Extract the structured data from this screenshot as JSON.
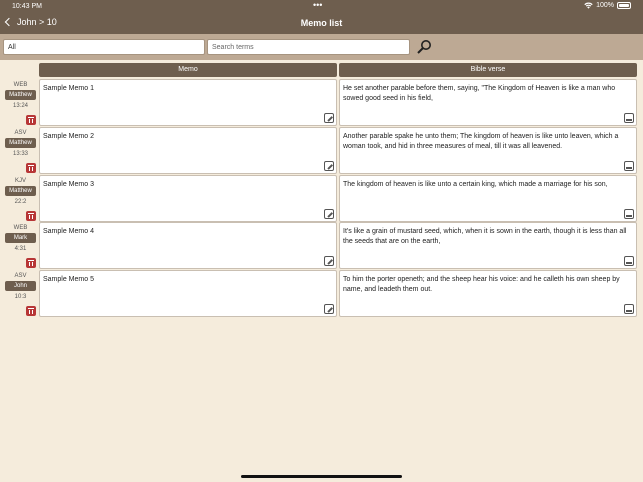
{
  "status": {
    "time": "10:43 PM",
    "battery": "100%",
    "dots": "•••"
  },
  "nav": {
    "back_label": "John > 10",
    "title": "Memo list"
  },
  "filter": {
    "version_value": "All",
    "search_placeholder": "Search terms"
  },
  "columns": {
    "memo": "Memo",
    "verse": "Bible verse"
  },
  "rows": [
    {
      "version": "WEB",
      "book": "Matthew",
      "ref": "13:24",
      "memo": "Sample Memo 1",
      "verse": "He set another parable before them, saying, \"The Kingdom of Heaven is like a man who sowed good seed in his field,"
    },
    {
      "version": "ASV",
      "book": "Matthew",
      "ref": "13:33",
      "memo": "Sample Memo 2",
      "verse": "Another parable spake he unto them; The kingdom of heaven is like unto leaven, which a woman took, and hid in three measures of meal, till it was all leavened."
    },
    {
      "version": "KJV",
      "book": "Matthew",
      "ref": "22:2",
      "memo": "Sample Memo 3",
      "verse": "The kingdom of heaven is like unto a certain king, which made a marriage for his son,"
    },
    {
      "version": "WEB",
      "book": "Mark",
      "ref": "4:31",
      "memo": "Sample Memo 4",
      "verse": "It's like a grain of mustard seed, which, when it is sown in the earth, though it is less than all the seeds that are on the earth,"
    },
    {
      "version": "ASV",
      "book": "John",
      "ref": "10:3",
      "memo": "Sample Memo 5",
      "verse": "To him the porter openeth; and the sheep hear his voice: and he calleth his own sheep by name, and leadeth them out."
    }
  ]
}
